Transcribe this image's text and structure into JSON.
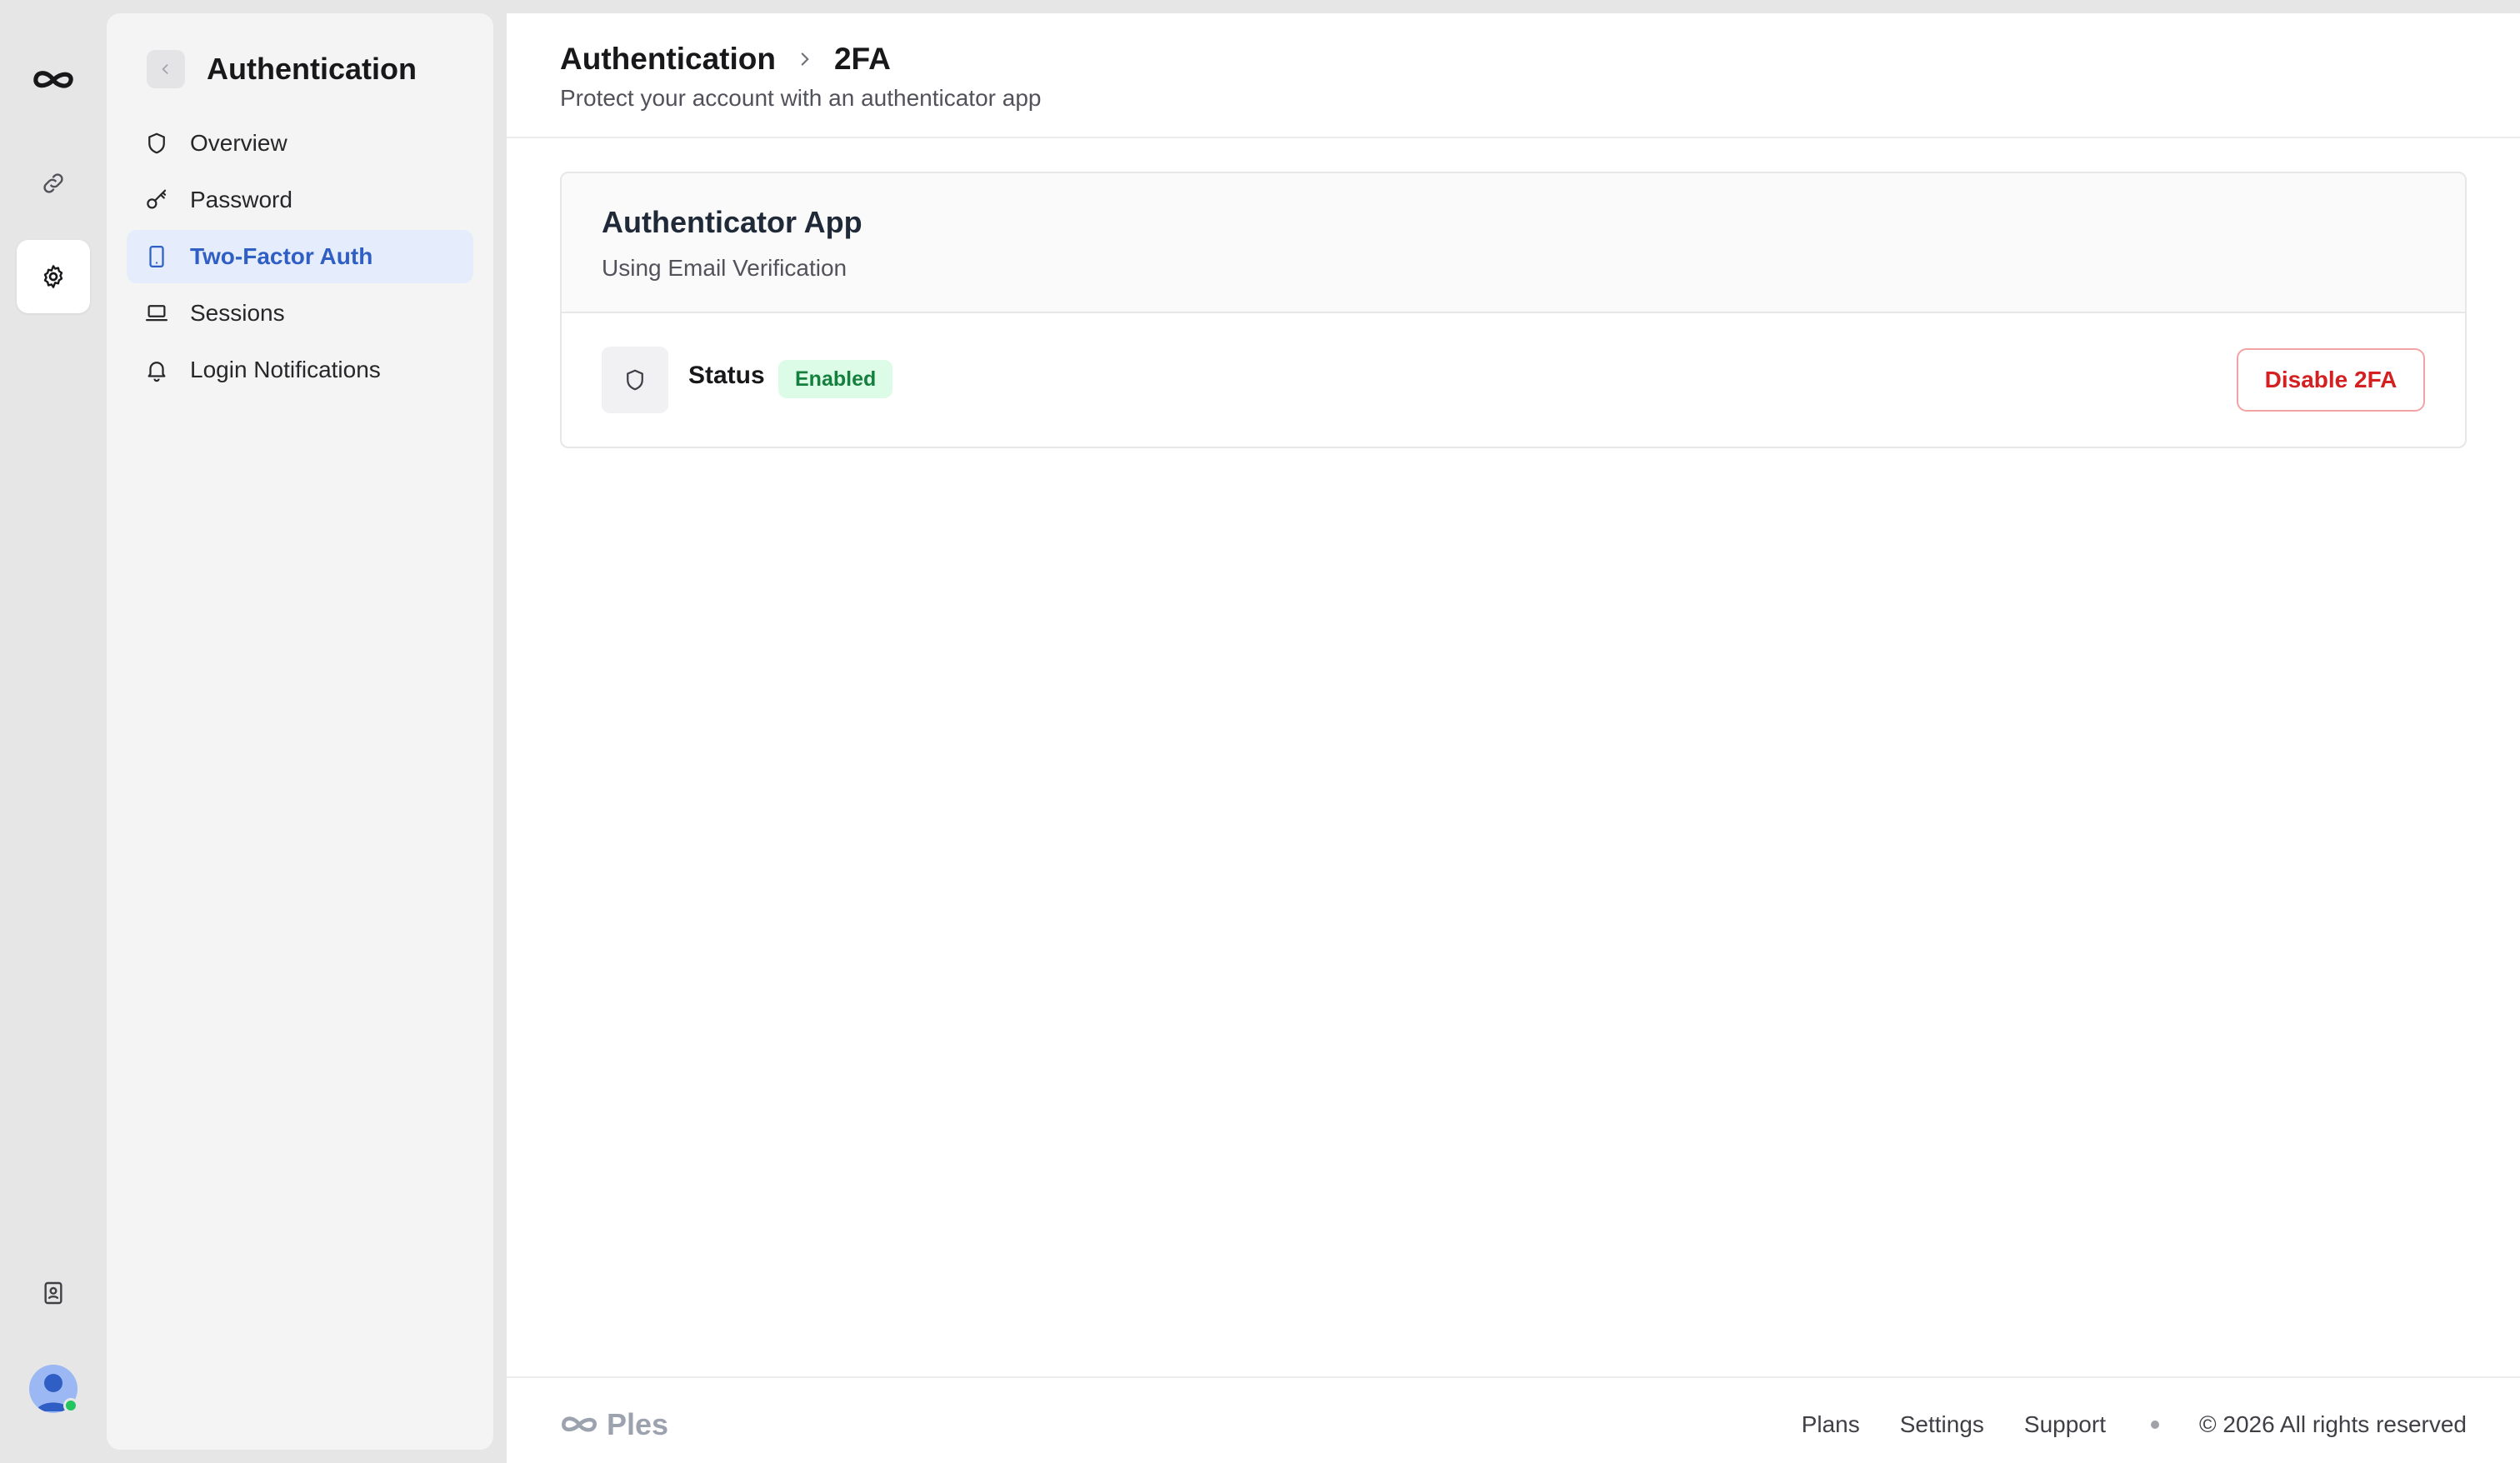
{
  "sidebar": {
    "title": "Authentication",
    "items": [
      {
        "label": "Overview",
        "icon": "shield-icon"
      },
      {
        "label": "Password",
        "icon": "key-icon"
      },
      {
        "label": "Two-Factor Auth",
        "icon": "phone-icon",
        "active": true
      },
      {
        "label": "Sessions",
        "icon": "laptop-icon"
      },
      {
        "label": "Login Notifications",
        "icon": "bell-icon"
      }
    ]
  },
  "header": {
    "breadcrumb": [
      "Authentication",
      "2FA"
    ],
    "subtitle": "Protect your account with an authenticator app"
  },
  "card": {
    "title": "Authenticator App",
    "subtitle": "Using Email Verification",
    "status_label": "Status",
    "status_badge": "Enabled",
    "action_label": "Disable 2FA"
  },
  "footer": {
    "brand": "Ples",
    "links": [
      "Plans",
      "Settings",
      "Support"
    ],
    "copyright": "© 2026 All rights reserved"
  },
  "colors": {
    "accent": "#2f5fc4",
    "active_bg": "#e5ecfb",
    "success_bg": "#dcfce7",
    "success_text": "#15803d",
    "danger": "#d42020"
  }
}
